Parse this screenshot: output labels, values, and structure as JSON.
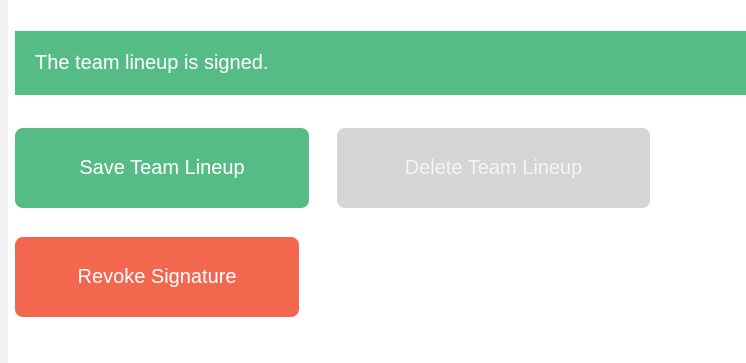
{
  "status": {
    "message": "The team lineup is signed."
  },
  "actions": {
    "save_label": "Save Team Lineup",
    "delete_label": "Delete Team Lineup",
    "revoke_label": "Revoke Signature"
  },
  "colors": {
    "success": "#55bc86",
    "disabled": "#d5d5d5",
    "danger": "#f4674f"
  }
}
